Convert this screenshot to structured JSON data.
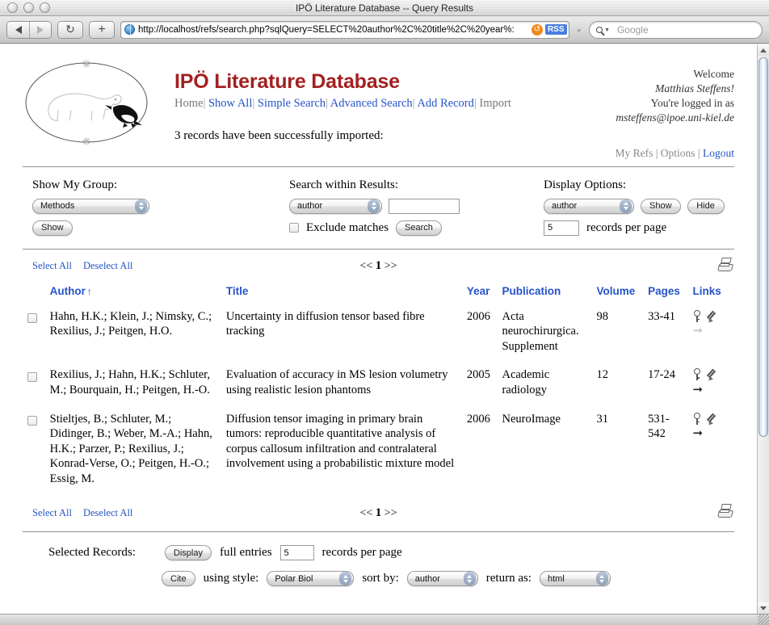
{
  "window": {
    "title": "IPÖ Literature Database -- Query Results"
  },
  "browser": {
    "back_icon": "back-arrow-icon",
    "forward_icon": "forward-arrow-icon",
    "reload_label": "↻",
    "add_label": "+",
    "url": "http://localhost/refs/search.php?sqlQuery=SELECT%20author%2C%20title%2C%20year%:",
    "reload_small": "↺",
    "rss_label": "RSS",
    "chevron": "«",
    "search_placeholder": "Google",
    "search_value": ""
  },
  "masthead": {
    "site_title": "IPÖ Literature Database",
    "nav": [
      {
        "label": "Home",
        "link": false
      },
      {
        "label": "Show All",
        "link": true
      },
      {
        "label": "Simple Search",
        "link": true
      },
      {
        "label": "Advanced Search",
        "link": true
      },
      {
        "label": "Add Record",
        "link": true
      },
      {
        "label": "Import",
        "link": false
      }
    ],
    "nav_separator": "|",
    "welcome_line1": "Welcome",
    "welcome_name": "Matthias Steffens!",
    "welcome_line3": "You're logged in as",
    "welcome_email": "msteffens@ipoe.uni-kiel.de",
    "user_links": [
      {
        "label": "My Refs",
        "link": false
      },
      {
        "label": "Options",
        "link": false
      },
      {
        "label": "Logout",
        "link": true
      }
    ],
    "status_message": "3 records have been successfully imported:"
  },
  "controls": {
    "group": {
      "label": "Show My Group:",
      "select_value": "Methods",
      "button_label": "Show"
    },
    "search_within": {
      "label": "Search within Results:",
      "field_value": "author",
      "query_value": "",
      "exclude_label": "Exclude matches",
      "exclude_checked": false,
      "button_label": "Search"
    },
    "display": {
      "label": "Display Options:",
      "field_value": "author",
      "show_label": "Show",
      "hide_label": "Hide",
      "records_per_page": "5",
      "records_per_page_label": "records per page"
    }
  },
  "resultbar": {
    "select_all": "Select All",
    "deselect_all": "Deselect All",
    "prev": "<<",
    "page": "1",
    "next": ">>",
    "print_icon": "printer-icon"
  },
  "table": {
    "columns": [
      {
        "key": "author",
        "label": "Author",
        "sorted": true,
        "sort_glyph": "↑"
      },
      {
        "key": "title",
        "label": "Title"
      },
      {
        "key": "year",
        "label": "Year"
      },
      {
        "key": "publication",
        "label": "Publication"
      },
      {
        "key": "volume",
        "label": "Volume"
      },
      {
        "key": "pages",
        "label": "Pages"
      },
      {
        "key": "links",
        "label": "Links"
      }
    ],
    "rows": [
      {
        "checked": false,
        "author": "Hahn, H.K.; Klein, J.; Nimsky, C.; Rexilius, J.; Peitgen, H.O.",
        "title": "Uncertainty in diffusion tensor based fibre tracking",
        "year": "2006",
        "publication": "Acta neurochirurgica. Supplement",
        "volume": "98",
        "pages": "33-41",
        "links": {
          "key": true,
          "edit": true,
          "arrow": true,
          "arrow_faded": true
        }
      },
      {
        "checked": false,
        "author": "Rexilius, J.; Hahn, H.K.; Schluter, M.; Bourquain, H.; Peitgen, H.-O.",
        "title": "Evaluation of accuracy in MS lesion volumetry using realistic lesion phantoms",
        "year": "2005",
        "publication": "Academic radiology",
        "volume": "12",
        "pages": "17-24",
        "links": {
          "key": true,
          "edit": true,
          "arrow": true,
          "arrow_faded": false
        }
      },
      {
        "checked": false,
        "author": "Stieltjes, B.; Schluter, M.; Didinger, B.; Weber, M.-A.; Hahn, H.K.; Parzer, P.; Rexilius, J.; Konrad-Verse, O.; Peitgen, H.-O.; Essig, M.",
        "title": "Diffusion tensor imaging in primary brain tumors: reproducible quantitative analysis of corpus callosum infiltration and contralateral involvement using a probabilistic mixture model",
        "year": "2006",
        "publication": "NeuroImage",
        "volume": "31",
        "pages": "531-542",
        "links": {
          "key": true,
          "edit": true,
          "arrow": true,
          "arrow_faded": false
        }
      }
    ]
  },
  "footer": {
    "selected_records_label": "Selected Records:",
    "display_button": "Display",
    "full_entries_label": "full entries",
    "records_per_page": "5",
    "records_per_page_label": "records per page",
    "cite_button": "Cite",
    "using_style_label": "using style:",
    "style_value": "Polar Biol",
    "sort_by_label": "sort by:",
    "sort_by_value": "author",
    "return_as_label": "return as:",
    "return_as_value": "html"
  },
  "colors": {
    "brand_red": "#A32020",
    "link_blue": "#2554C7",
    "header_blue": "#2554C7"
  }
}
